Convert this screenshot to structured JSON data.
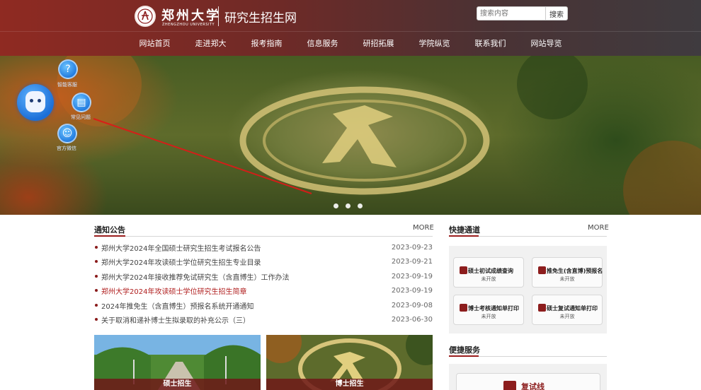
{
  "header": {
    "logo_cn": "郑州大学",
    "logo_en": "ZHENGZHOU UNIVERSITY",
    "site_name": "研究生招生网",
    "search_placeholder": "搜索内容",
    "search_button": "搜索"
  },
  "nav": [
    "网站首页",
    "走进郑大",
    "报考指南",
    "信息服务",
    "研招拓展",
    "学院纵览",
    "联系我们",
    "网站导览"
  ],
  "floating": {
    "items": [
      {
        "label": "智能客服",
        "icon": "question-icon"
      },
      {
        "label": "常见问题",
        "icon": "book-icon"
      },
      {
        "label": "官方微信",
        "icon": "wechat-icon"
      }
    ]
  },
  "notices": {
    "title": "通知公告",
    "more": "MORE",
    "items": [
      {
        "title": "郑州大学2024年全国硕士研究生招生考试报名公告",
        "date": "2023-09-23",
        "highlight": false
      },
      {
        "title": "郑州大学2024年攻读硕士学位研究生招生专业目录",
        "date": "2023-09-21",
        "highlight": false
      },
      {
        "title": "郑州大学2024年接收推荐免试研究生（含直博生）工作办法",
        "date": "2023-09-19",
        "highlight": false
      },
      {
        "title": "郑州大学2024年攻读硕士学位研究生招生简章",
        "date": "2023-09-19",
        "highlight": true
      },
      {
        "title": "2024年推免生（含直博生）预报名系统开通通知",
        "date": "2023-09-08",
        "highlight": false
      },
      {
        "title": "关于取消和递补博士生拟录取的补充公示（三）",
        "date": "2023-06-30",
        "highlight": false
      }
    ]
  },
  "cards": [
    {
      "caption": "硕士招生"
    },
    {
      "caption": "博士招生"
    }
  ],
  "quick": {
    "title": "快捷通道",
    "more": "MORE",
    "buttons": [
      {
        "label": "硕士初试成绩查询",
        "status": "未开放"
      },
      {
        "label": "推免生(含直博)预报名",
        "status": "未开放"
      },
      {
        "label": "博士考核通知单打印",
        "status": "未开放"
      },
      {
        "label": "硕士复试通知单打印",
        "status": "未开放"
      }
    ]
  },
  "services": {
    "title": "便捷服务",
    "items": [
      {
        "label": "复试线"
      }
    ]
  },
  "colors": {
    "accent": "#9a1d1d",
    "header_start": "#8f2a22",
    "header_end": "#3f3b3f"
  }
}
